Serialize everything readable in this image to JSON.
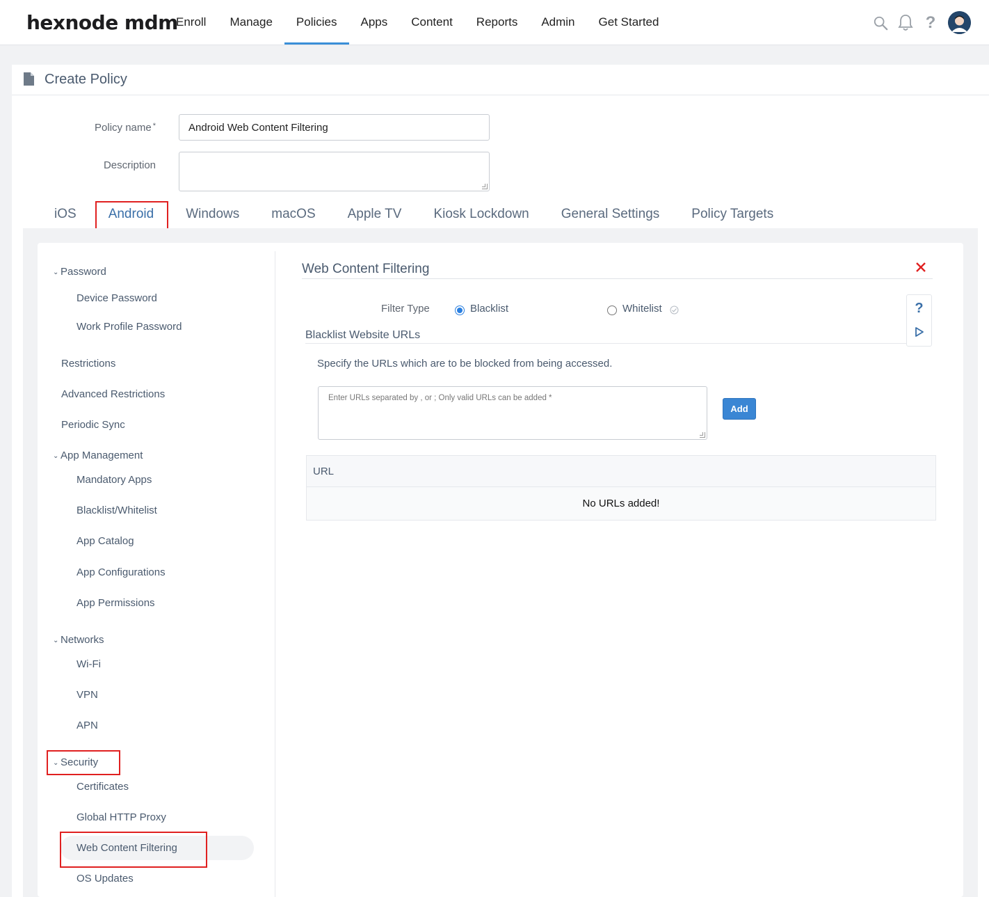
{
  "app": {
    "logo": "hexnode mdm"
  },
  "nav": {
    "items": [
      "Enroll",
      "Manage",
      "Policies",
      "Apps",
      "Content",
      "Reports",
      "Admin",
      "Get Started"
    ],
    "active": "Policies"
  },
  "topbar_icons": [
    "search-icon",
    "bell-icon",
    "help-icon",
    "user-avatar"
  ],
  "page": {
    "title": "Create Policy"
  },
  "form": {
    "policy_name_label": "Policy name",
    "required_mark": "*",
    "policy_name_value": "Android Web Content Filtering",
    "description_label": "Description",
    "description_value": ""
  },
  "platform_tabs": {
    "items": [
      "iOS",
      "Android",
      "Windows",
      "macOS",
      "Apple TV",
      "Kiosk Lockdown",
      "General Settings",
      "Policy Targets"
    ],
    "active": "Android"
  },
  "sidebar": {
    "groups": [
      {
        "label": "Password",
        "items": [
          "Device Password",
          "Work Profile Password"
        ]
      },
      {
        "label": "Restrictions"
      },
      {
        "label": "Advanced Restrictions"
      },
      {
        "label": "Periodic Sync"
      },
      {
        "label": "App Management",
        "items": [
          "Mandatory Apps",
          "Blacklist/Whitelist",
          "App Catalog",
          "App Configurations",
          "App Permissions"
        ]
      },
      {
        "label": "Networks",
        "items": [
          "Wi-Fi",
          "VPN",
          "APN"
        ]
      },
      {
        "label": "Security",
        "items": [
          "Certificates",
          "Global HTTP Proxy",
          "Web Content Filtering",
          "OS Updates"
        ]
      }
    ],
    "active_item": "Web Content Filtering"
  },
  "main": {
    "section_title": "Web Content Filtering",
    "filter_type_label": "Filter Type",
    "filter_options": [
      {
        "label": "Blacklist",
        "selected": true
      },
      {
        "label": "Whitelist",
        "selected": false
      }
    ],
    "subsection_title": "Blacklist Website URLs",
    "instruction": "Specify the URLs which are to be blocked from being accessed.",
    "url_input_placeholder": "Enter URLs separated by , or ;  Only valid URLs can be added *",
    "add_button": "Add",
    "table": {
      "columns": [
        "URL"
      ],
      "empty_message": "No URLs added!"
    },
    "help_labels": [
      "?"
    ]
  },
  "colors": {
    "accent": "#3a8fd8",
    "highlight": "#e02020",
    "button": "#3a86d4",
    "muted_text": "#4a5a6e"
  }
}
